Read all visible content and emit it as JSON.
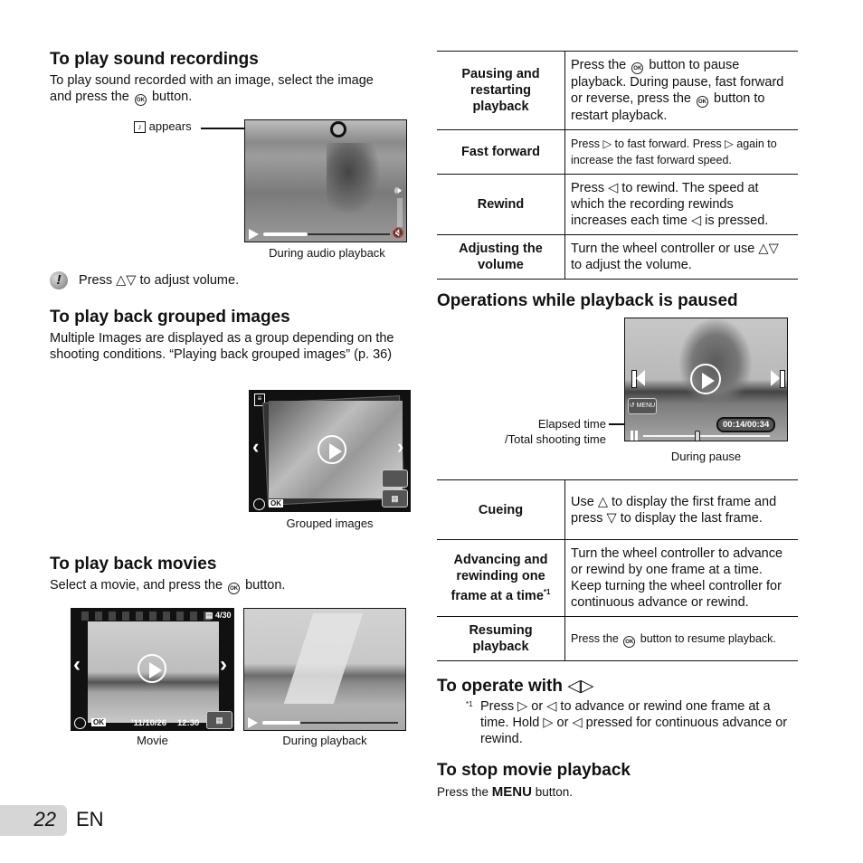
{
  "left": {
    "sound": {
      "title": "To play sound recordings",
      "text1": "To play sound recorded with an image, select the image",
      "text2a": "and press the",
      "text2b": "button.",
      "callout": "appears",
      "caption": "During audio playback",
      "note_a": "Press",
      "note_b": "to adjust volume."
    },
    "grouped": {
      "title": "To play back grouped images",
      "text": "Multiple Images are displayed as a group depending on the shooting conditions. “Playing back grouped images” (p. 36)",
      "caption": "Grouped images",
      "ok_label": "OK"
    },
    "movies": {
      "title": "To play back movies",
      "text_a": "Select a movie, and press the",
      "text_b": "button.",
      "movie_counter": "4/30",
      "movie_date": "’11/10/26",
      "movie_time": "12:30",
      "ok_label": "OK",
      "caption_movie": "Movie",
      "caption_playback": "During playback"
    }
  },
  "table1": {
    "rows": [
      {
        "head": "Pausing and restarting playback",
        "desc_a": "Press the",
        "desc_b": "button to pause playback. During pause, fast forward or reverse, press the",
        "desc_c": "button to restart playback."
      },
      {
        "head": "Fast forward",
        "desc_a": "Press",
        "desc_b": "to fast forward. Press",
        "desc_c": "again to increase the fast forward speed."
      },
      {
        "head": "Rewind",
        "desc_a": "Press",
        "desc_b": "to rewind. The speed at which the recording rewinds increases each time",
        "desc_c": "is pressed."
      },
      {
        "head": "Adjusting the volume",
        "desc_a": "Turn the wheel controller or use",
        "desc_b": "to adjust the volume."
      }
    ]
  },
  "paused": {
    "title": "Operations while playback is paused",
    "callout_1": "Elapsed time",
    "callout_2": "/Total shooting time",
    "time_readout": "00:14/00:34",
    "menu_label": "MENU",
    "caption": "During pause",
    "progress_fraction": 0.41
  },
  "table2": {
    "rows": [
      {
        "head": "Cueing",
        "desc_a": "Use",
        "desc_b": "to display the first frame and press",
        "desc_c": "to display the last frame."
      },
      {
        "head": "Advancing and rewinding one frame at a time",
        "head_sup": "*1",
        "desc": "Turn the wheel controller to advance or rewind by one frame at a time. Keep turning the wheel controller for continuous advance or rewind."
      },
      {
        "head": "Resuming playback",
        "desc_a": "Press the",
        "desc_b": "button to resume playback."
      }
    ]
  },
  "operate": {
    "title": "To operate with",
    "footnote_mark": "*1",
    "fn_a": "Press",
    "fn_b": "or",
    "fn_c": "to advance or rewind one frame at a time. Hold",
    "fn_d": "or",
    "fn_e": "pressed for continuous advance or rewind."
  },
  "stop": {
    "title": "To stop movie playback",
    "text_a": "Press the",
    "menu": "MENU",
    "text_b": "button."
  },
  "footer": {
    "page_number": "22",
    "language": "EN"
  },
  "ok_glyph": "OK",
  "audio_progress_fraction": 0.35,
  "movie_progress_fraction": 0.28
}
